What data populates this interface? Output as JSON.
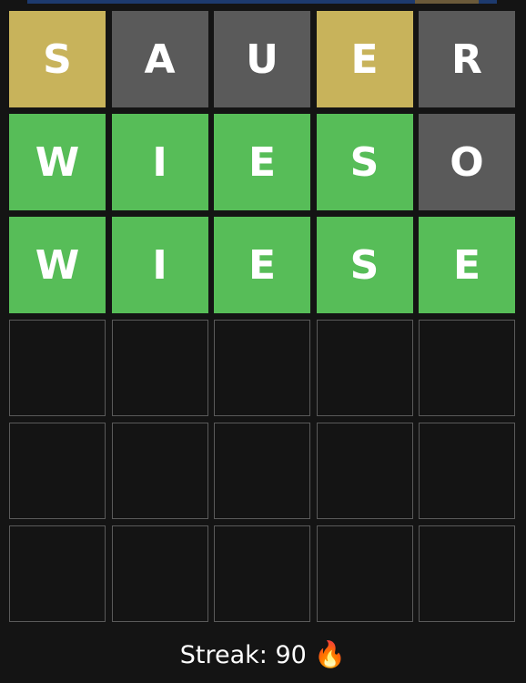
{
  "colors": {
    "correct": "#57bd58",
    "present": "#c8b35b",
    "absent": "#5a5a5a",
    "background": "#141414"
  },
  "board": {
    "rows": [
      [
        {
          "letter": "S",
          "state": "present"
        },
        {
          "letter": "A",
          "state": "absent"
        },
        {
          "letter": "U",
          "state": "absent"
        },
        {
          "letter": "E",
          "state": "present"
        },
        {
          "letter": "R",
          "state": "absent"
        }
      ],
      [
        {
          "letter": "W",
          "state": "correct"
        },
        {
          "letter": "I",
          "state": "correct"
        },
        {
          "letter": "E",
          "state": "correct"
        },
        {
          "letter": "S",
          "state": "correct"
        },
        {
          "letter": "O",
          "state": "absent"
        }
      ],
      [
        {
          "letter": "W",
          "state": "correct"
        },
        {
          "letter": "I",
          "state": "correct"
        },
        {
          "letter": "E",
          "state": "correct"
        },
        {
          "letter": "S",
          "state": "correct"
        },
        {
          "letter": "E",
          "state": "correct"
        }
      ],
      [
        {
          "letter": "",
          "state": "empty"
        },
        {
          "letter": "",
          "state": "empty"
        },
        {
          "letter": "",
          "state": "empty"
        },
        {
          "letter": "",
          "state": "empty"
        },
        {
          "letter": "",
          "state": "empty"
        }
      ],
      [
        {
          "letter": "",
          "state": "empty"
        },
        {
          "letter": "",
          "state": "empty"
        },
        {
          "letter": "",
          "state": "empty"
        },
        {
          "letter": "",
          "state": "empty"
        },
        {
          "letter": "",
          "state": "empty"
        }
      ],
      [
        {
          "letter": "",
          "state": "empty"
        },
        {
          "letter": "",
          "state": "empty"
        },
        {
          "letter": "",
          "state": "empty"
        },
        {
          "letter": "",
          "state": "empty"
        },
        {
          "letter": "",
          "state": "empty"
        }
      ]
    ]
  },
  "footer": {
    "streak_text": "Streak: 90",
    "streak_icon": "fire-icon",
    "streak_glyph": "🔥"
  }
}
